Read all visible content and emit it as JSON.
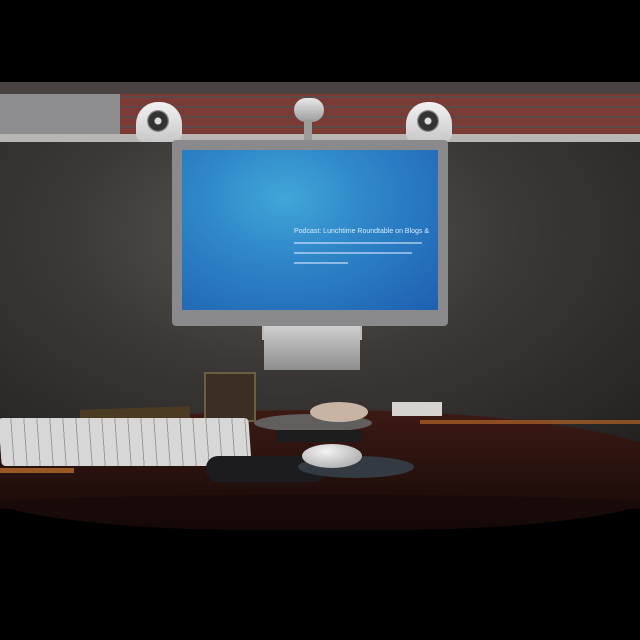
{
  "scene": {
    "description_type": "desk with monitor photograph"
  },
  "screen_text": {
    "title": "Podcast: Lunchtime Roundtable on Blogs &"
  }
}
